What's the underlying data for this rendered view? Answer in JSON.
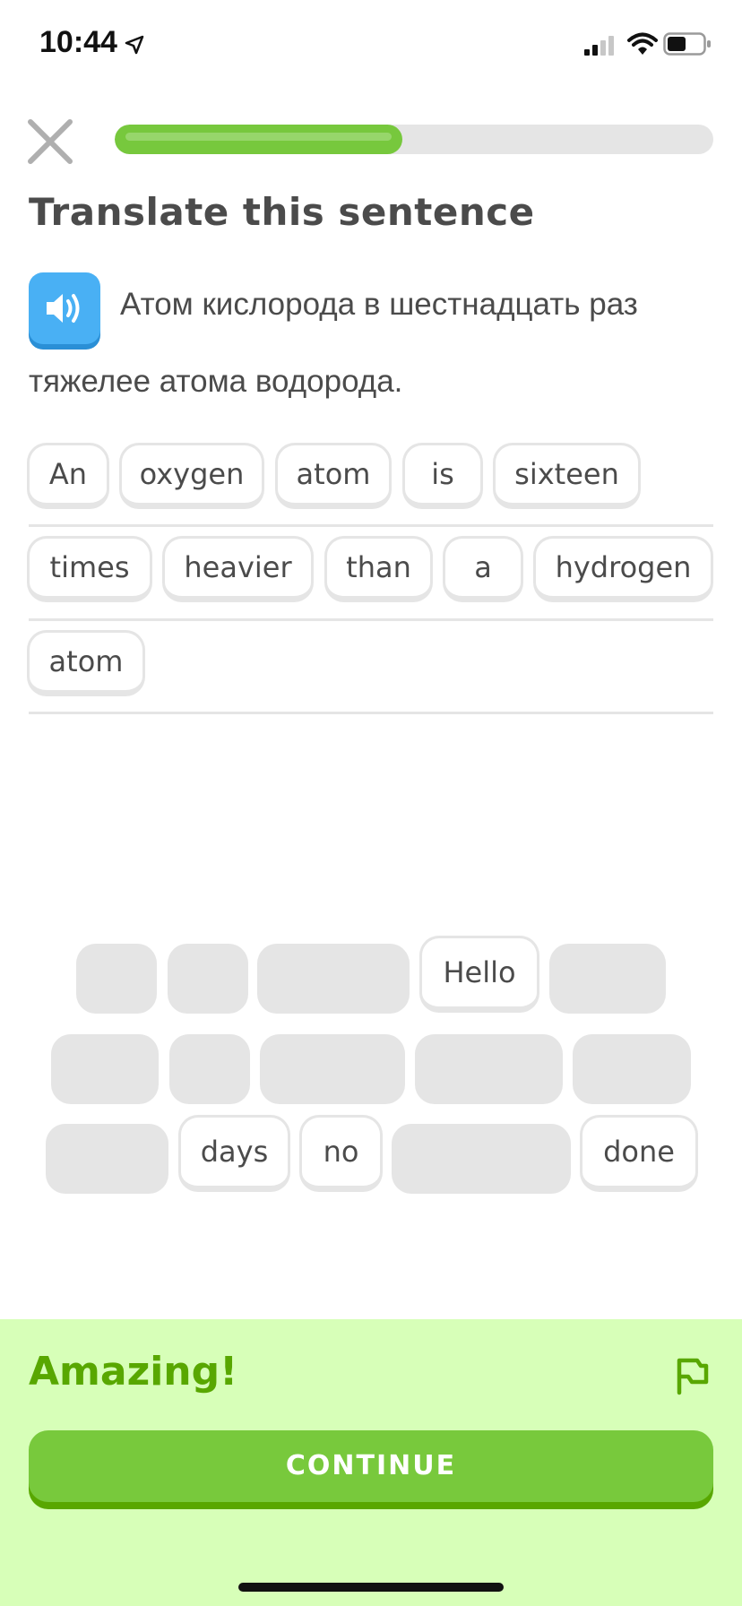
{
  "status_bar": {
    "time": "10:44"
  },
  "lesson": {
    "progress": 0.48
  },
  "prompt": {
    "title": "Translate this sentence",
    "source_line1": "Атом кислорода в шестнадцать раз",
    "source_line2": "тяжелее атома водорода."
  },
  "answer_words": [
    "An",
    "oxygen",
    "atom",
    "is",
    "sixteen",
    "times",
    "heavier",
    "than",
    "a",
    "hydrogen",
    "atom"
  ],
  "word_bank": [
    "Hello",
    "days",
    "no",
    "done"
  ],
  "feedback": {
    "title": "Amazing!",
    "continue_label": "CONTINUE"
  },
  "colors": {
    "accent_green": "#78c93c",
    "feedback_bg": "#d7ffb8",
    "speaker_blue": "#49b0f4"
  }
}
